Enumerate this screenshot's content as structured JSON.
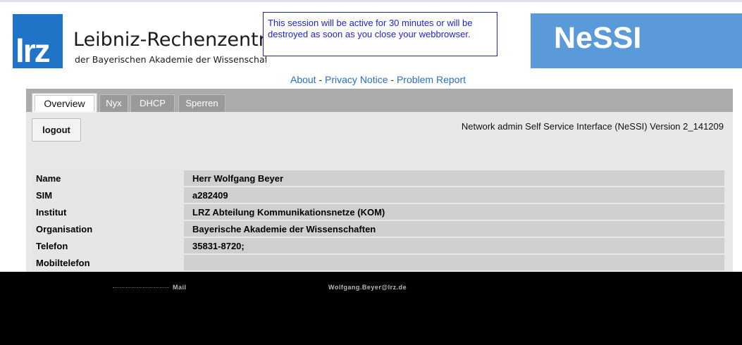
{
  "header": {
    "logo_text": "lrz",
    "org_name": "Leibniz-Rechenzentrum",
    "org_subtitle": "der Bayerischen Akademie der Wissenschaften",
    "session_note": "This session will be active for 30 minutes or will be destroyed as soon as you close your webbrowser.",
    "product_name": "NeSSI"
  },
  "links": {
    "about": "About",
    "separator": "-",
    "privacy": "Privacy Notice",
    "report": "Problem Report"
  },
  "tabs": [
    "Overview",
    "Nyx",
    "DHCP",
    "Sperren"
  ],
  "toolbar": {
    "logout_label": "logout",
    "version_text": "Network admin Self Service Interface (NeSSI) Version 2_141209"
  },
  "profile": [
    {
      "label": "Name",
      "value": "Herr Wolfgang Beyer"
    },
    {
      "label": "SIM",
      "value": "a282409"
    },
    {
      "label": "Institut",
      "value": "LRZ Abteilung Kommunikationsnetze (KOM)"
    },
    {
      "label": "Organisation",
      "value": "Bayerische Akademie der Wissenschaften"
    },
    {
      "label": "Telefon",
      "value": "35831-8720;"
    },
    {
      "label": "Mobiltelefon",
      "value": ""
    }
  ],
  "obscured_row": {
    "label": "Mail",
    "value": "Wolfgang.Beyer@lrz.de"
  },
  "colors": {
    "lrz_blue": "#1f74c8",
    "nessi_blue": "#5b9ad8",
    "link_blue": "#2a6fc4",
    "notice_blue": "#2222cc"
  }
}
